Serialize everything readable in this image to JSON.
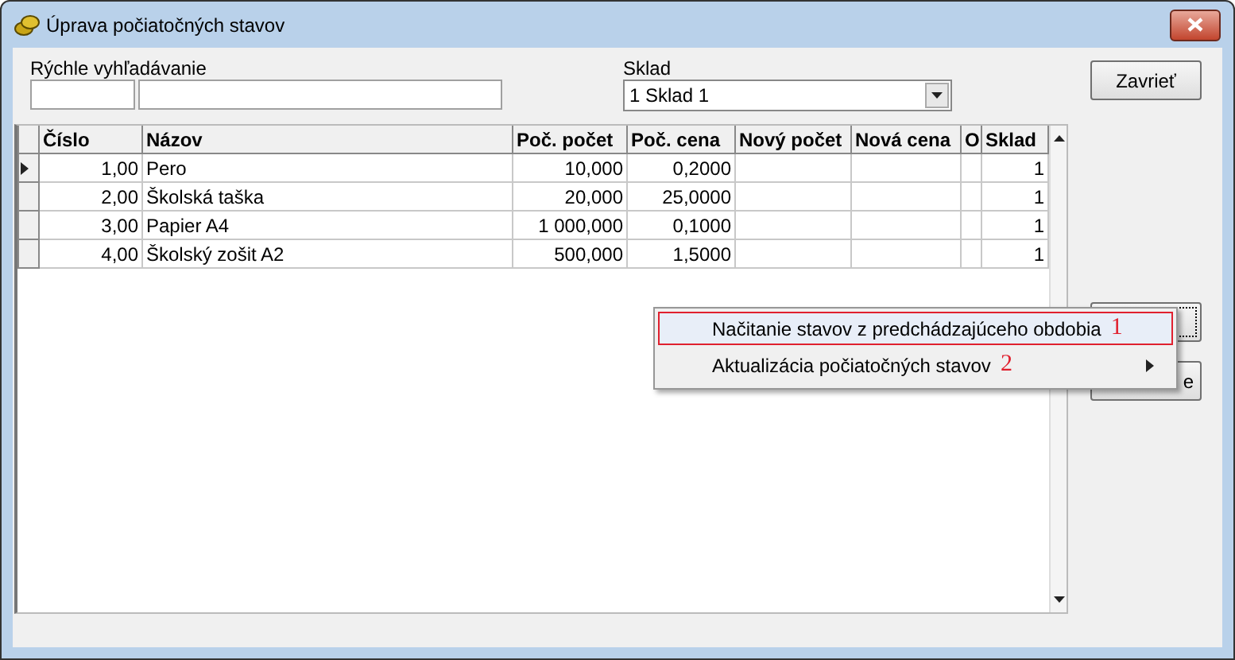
{
  "window": {
    "title": "Úprava počiatočných stavov"
  },
  "search": {
    "label": "Rýchle vyhľadávanie"
  },
  "warehouse": {
    "label": "Sklad",
    "value": "1  Sklad 1"
  },
  "buttons": [
    {
      "label": "Zavrieť",
      "focused": false
    },
    {
      "focused": true
    },
    {
      "label": "e",
      "focused": false
    }
  ],
  "table": {
    "columns": [
      "Číslo",
      "Názov",
      "Poč. počet",
      "Poč. cena",
      "Nový počet",
      "Nová cena",
      "O",
      "Sklad"
    ],
    "rows": [
      {
        "selected": true,
        "cells": [
          "1,00",
          "Pero",
          "10,000",
          "0,2000",
          "",
          "",
          "",
          "1"
        ]
      },
      {
        "selected": false,
        "cells": [
          "2,00",
          "Školská taška",
          "20,000",
          "25,0000",
          "",
          "",
          "",
          "1"
        ]
      },
      {
        "selected": false,
        "cells": [
          "3,00",
          "Papier A4",
          "1 000,000",
          "0,1000",
          "",
          "",
          "",
          "1"
        ]
      },
      {
        "selected": false,
        "cells": [
          "4,00",
          "Školský zošit A2",
          "500,000",
          "1,5000",
          "",
          "",
          "",
          "1"
        ]
      }
    ]
  },
  "context_menu": {
    "items": [
      {
        "label": "Načitanie stavov z predchádzajúceho obdobia",
        "marker": "1",
        "selected": true,
        "submenu": false
      },
      {
        "label": "Aktualizácia počiatočných stavov",
        "marker": "2",
        "selected": false,
        "submenu": true
      }
    ]
  }
}
